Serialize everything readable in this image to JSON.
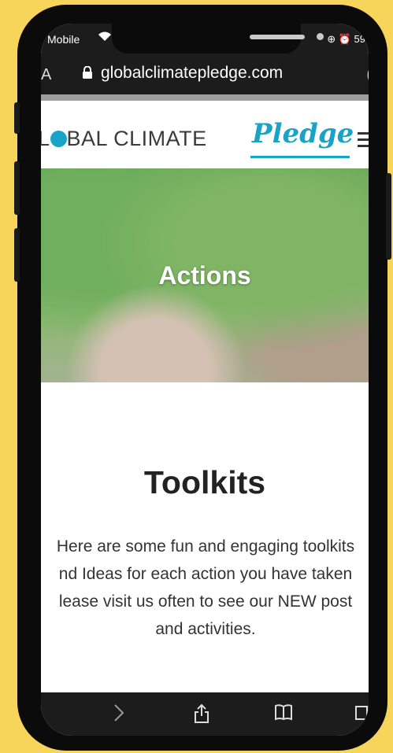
{
  "status": {
    "carrier": "Mobile",
    "right": "⊕ ⏰ 59"
  },
  "browser": {
    "url": "globalclimatepledge.com",
    "url_left_char": "A",
    "url_right_char": "(",
    "toolbar_icons": [
      "back-icon",
      "forward-icon",
      "share-icon",
      "bookmarks-icon",
      "tabs-icon"
    ]
  },
  "site": {
    "logo_prefix": "L",
    "logo_suffix": "BAL CLIMATE",
    "logo_script": "Pledge",
    "hero_title": "Actions",
    "section_title": "Toolkits",
    "body_lines": [
      "Here are some fun and engaging toolkits",
      "nd Ideas for each action you have taken",
      "lease visit us often to see our NEW post",
      "and activities."
    ]
  },
  "colors": {
    "background": "#f7d55a",
    "brand": "#1aa3c6"
  }
}
